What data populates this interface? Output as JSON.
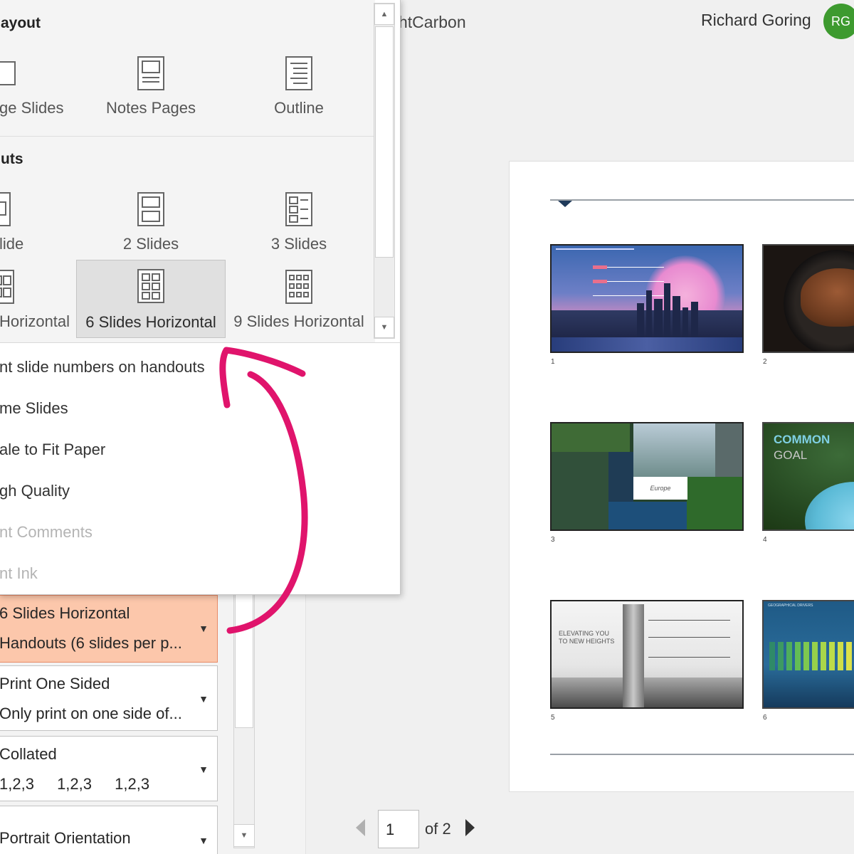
{
  "header": {
    "doc_title": "htCarbon",
    "user_name": "Richard Goring",
    "avatar_initials": "RG"
  },
  "layout_menu": {
    "section_print_layout": "ayout",
    "section_handouts": "uts",
    "print_layout_options": [
      "ge Slides",
      "Notes Pages",
      "Outline"
    ],
    "handout_options": [
      "lide",
      "2 Slides",
      "3 Slides",
      "Horizontal",
      "6 Slides Horizontal",
      "9 Slides Horizontal"
    ],
    "selected_option": "6 Slides Horizontal",
    "menu_items": [
      {
        "label": "nt slide numbers on handouts",
        "enabled": true
      },
      {
        "label": "me Slides",
        "enabled": true
      },
      {
        "label": "ale to Fit Paper",
        "enabled": true
      },
      {
        "label": "gh Quality",
        "enabled": true
      },
      {
        "label": "nt Comments",
        "enabled": false
      },
      {
        "label": "nt Ink",
        "enabled": false
      }
    ]
  },
  "settings": {
    "layout": {
      "title": "6 Slides Horizontal",
      "subtitle": "Handouts (6 slides per p..."
    },
    "sides": {
      "title": "Print One Sided",
      "subtitle": "Only print on one side of..."
    },
    "collation": {
      "title": "Collated",
      "values": [
        "1,2,3",
        "1,2,3",
        "1,2,3"
      ]
    },
    "orientation": {
      "title": "Portrait Orientation"
    }
  },
  "preview": {
    "slide_numbers": [
      "1",
      "2",
      "3",
      "4",
      "5",
      "6"
    ],
    "slide4_heading": "COMMON",
    "slide4_subheading": "GOAL",
    "slide3_card": "Europe",
    "slide5_caption": "ELEVATING YOU TO NEW HEIGHTS",
    "slide6_header": "GEOGRAPHICAL DRIVERS"
  },
  "navigation": {
    "current_page": "1",
    "total_label": "of 2"
  },
  "colors": {
    "highlight": "#fcc7ab",
    "avatar": "#3d9a2f",
    "annotation": "#e0146c"
  },
  "icons": {
    "page_layout": [
      "full-page-slide-icon",
      "notes-pages-icon",
      "outline-icon"
    ],
    "handouts": [
      "one-slide-icon",
      "two-slides-icon",
      "three-slides-icon",
      "four-horizontal-icon",
      "six-horizontal-icon",
      "nine-horizontal-icon"
    ]
  }
}
